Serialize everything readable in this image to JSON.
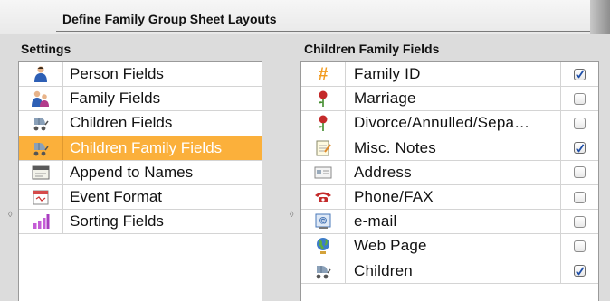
{
  "header": {
    "title": "Define Family Group Sheet Layouts"
  },
  "settings": {
    "label": "Settings",
    "items": [
      {
        "label": "Person Fields",
        "icon": "person-icon",
        "selected": false
      },
      {
        "label": "Family Fields",
        "icon": "family-icon",
        "selected": false
      },
      {
        "label": "Children Fields",
        "icon": "baby-stroller-icon",
        "selected": false
      },
      {
        "label": "Children Family Fields",
        "icon": "baby-stroller-icon",
        "selected": true
      },
      {
        "label": "Append to Names",
        "icon": "name-tag-icon",
        "selected": false
      },
      {
        "label": "Event Format",
        "icon": "calendar-icon",
        "selected": false
      },
      {
        "label": "Sorting Fields",
        "icon": "bar-chart-icon",
        "selected": false
      }
    ]
  },
  "children_fields": {
    "label": "Children Family Fields",
    "items": [
      {
        "label": "Family ID",
        "icon": "hash-icon",
        "checked": true
      },
      {
        "label": "Marriage",
        "icon": "rose-icon",
        "checked": false
      },
      {
        "label": "Divorce/Annulled/Sepa…",
        "icon": "rose-icon",
        "checked": false
      },
      {
        "label": "Misc. Notes",
        "icon": "notepad-icon",
        "checked": true
      },
      {
        "label": "Address",
        "icon": "address-card-icon",
        "checked": false
      },
      {
        "label": "Phone/FAX",
        "icon": "telephone-icon",
        "checked": false
      },
      {
        "label": "e-mail",
        "icon": "email-icon",
        "checked": false
      },
      {
        "label": "Web Page",
        "icon": "globe-icon",
        "checked": false
      },
      {
        "label": "Children",
        "icon": "baby-stroller-icon",
        "checked": true
      }
    ]
  },
  "colors": {
    "selection": "#fbb03b",
    "check": "#1f4fa8"
  }
}
